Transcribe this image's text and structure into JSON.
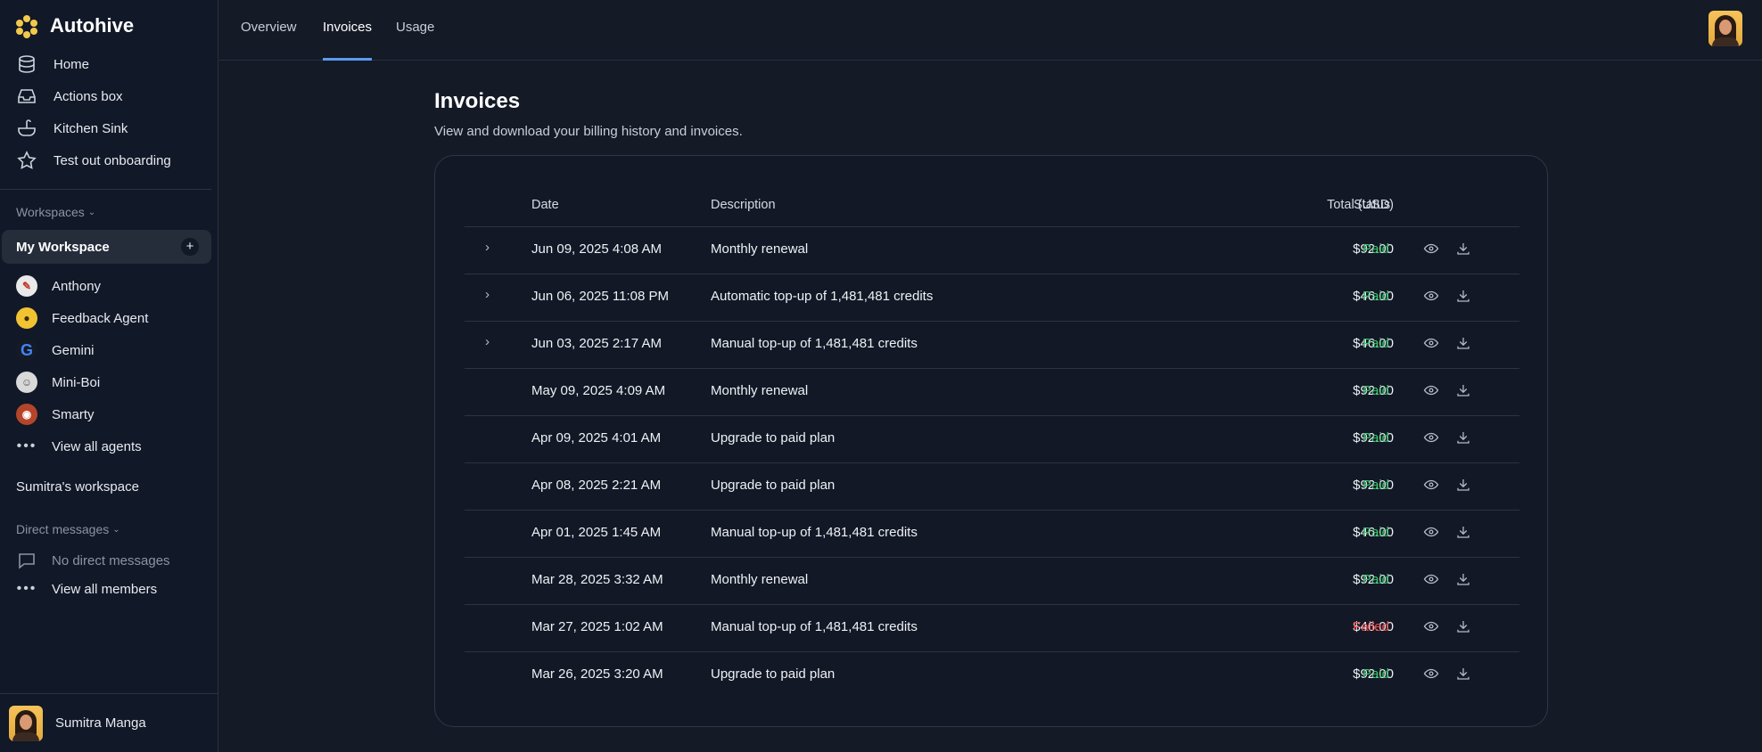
{
  "app": {
    "name": "Autohive"
  },
  "sidebar": {
    "nav": [
      {
        "label": "Home",
        "icon": "database-icon"
      },
      {
        "label": "Actions box",
        "icon": "inbox-icon"
      },
      {
        "label": "Kitchen Sink",
        "icon": "sink-icon"
      },
      {
        "label": "Test out onboarding",
        "icon": "star-icon"
      }
    ],
    "workspaces_label": "Workspaces",
    "active_workspace": "My Workspace",
    "add_symbol": "+",
    "agents": [
      {
        "label": "Anthony",
        "color": "#e9e9e9"
      },
      {
        "label": "Feedback Agent",
        "color": "#f1c232"
      },
      {
        "label": "Gemini",
        "color": "#ffffff"
      },
      {
        "label": "Mini-Boi",
        "color": "#d9d9d9"
      },
      {
        "label": "Smarty",
        "color": "#b5452a"
      }
    ],
    "view_all_agents": "View all agents",
    "other_workspace": "Sumitra's workspace",
    "direct_messages_label": "Direct messages",
    "no_direct_messages": "No direct messages",
    "view_all_members": "View all members",
    "user_name": "Sumitra Manga"
  },
  "tabs": [
    {
      "label": "Overview",
      "active": false
    },
    {
      "label": "Invoices",
      "active": true
    },
    {
      "label": "Usage",
      "active": false
    }
  ],
  "page": {
    "title": "Invoices",
    "subtitle": "View and download your billing history and invoices."
  },
  "table": {
    "headers": {
      "date": "Date",
      "description": "Description",
      "total": "Total (USD)",
      "status": "Status"
    },
    "rows": [
      {
        "date": "Jun 09, 2025 4:08 AM",
        "description": "Monthly renewal",
        "total": "$92.00",
        "status": "Paid",
        "expandable": true
      },
      {
        "date": "Jun 06, 2025 11:08 PM",
        "description": "Automatic top-up of 1,481,481 credits",
        "total": "$46.00",
        "status": "Paid",
        "expandable": true
      },
      {
        "date": "Jun 03, 2025 2:17 AM",
        "description": "Manual top-up of 1,481,481 credits",
        "total": "$46.00",
        "status": "Paid",
        "expandable": true
      },
      {
        "date": "May 09, 2025 4:09 AM",
        "description": "Monthly renewal",
        "total": "$92.00",
        "status": "Paid",
        "expandable": false
      },
      {
        "date": "Apr 09, 2025 4:01 AM",
        "description": "Upgrade to paid plan",
        "total": "$92.00",
        "status": "Paid",
        "expandable": false
      },
      {
        "date": "Apr 08, 2025 2:21 AM",
        "description": "Upgrade to paid plan",
        "total": "$92.00",
        "status": "Paid",
        "expandable": false
      },
      {
        "date": "Apr 01, 2025 1:45 AM",
        "description": "Manual top-up of 1,481,481 credits",
        "total": "$46.00",
        "status": "Paid",
        "expandable": false
      },
      {
        "date": "Mar 28, 2025 3:32 AM",
        "description": "Monthly renewal",
        "total": "$92.00",
        "status": "Paid",
        "expandable": false
      },
      {
        "date": "Mar 27, 2025 1:02 AM",
        "description": "Manual top-up of 1,481,481 credits",
        "total": "$46.00",
        "status": "Failed",
        "expandable": false
      },
      {
        "date": "Mar 26, 2025 3:20 AM",
        "description": "Upgrade to paid plan",
        "total": "$92.00",
        "status": "Paid",
        "expandable": false
      }
    ]
  },
  "colors": {
    "accent": "#5b9bf0",
    "paid": "#3ec46d",
    "failed": "#ef4c4c",
    "logo": "#f2c94c"
  }
}
